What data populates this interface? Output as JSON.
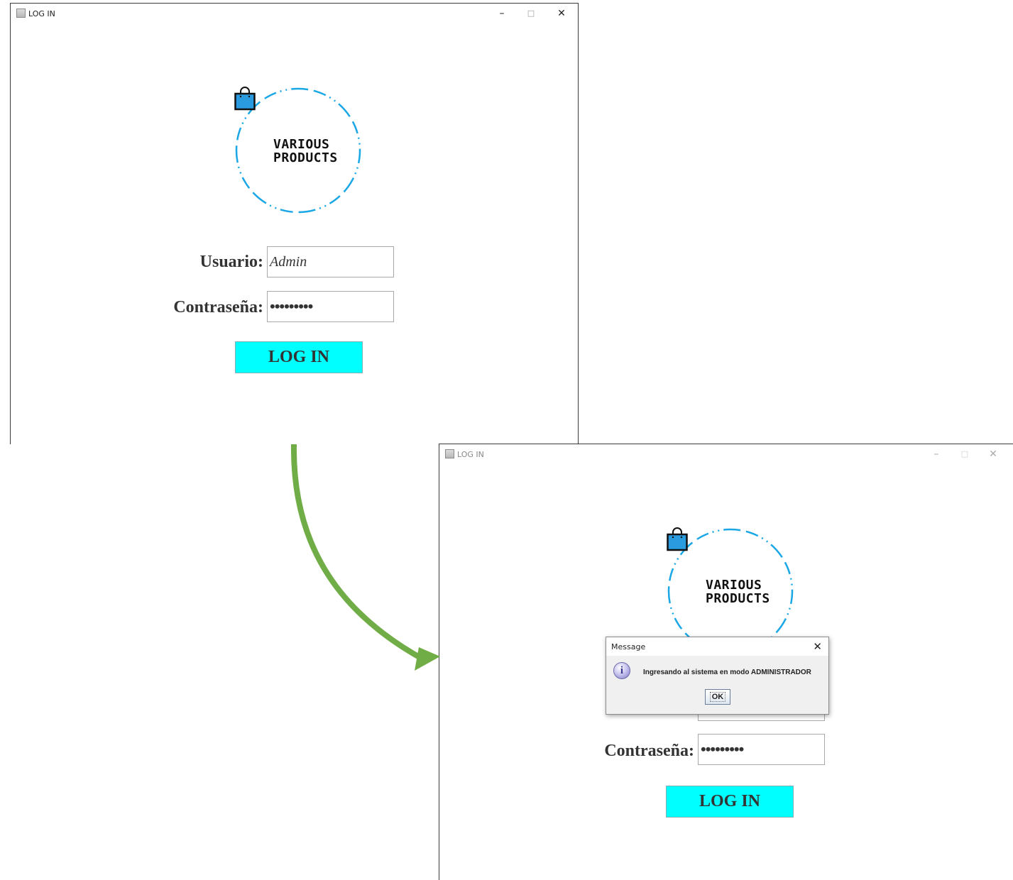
{
  "colors": {
    "accent_cyan": "#00ffff",
    "logo_ring": "#1aa7e6",
    "bag_blue": "#2b9be0",
    "arrow_green": "#70ad47"
  },
  "icons": {
    "app": "java-app-icon",
    "bag": "shopping-bag-icon",
    "info": "information-icon"
  },
  "window_before": {
    "title": "LOG IN",
    "controls": {
      "minimize": "–",
      "maximize": "□",
      "close": "✕"
    },
    "logo": {
      "line1": "VARIOUS",
      "line2": "PRODUCTS"
    },
    "form": {
      "user_label": "Usuario:",
      "user_value": "Admin",
      "pass_label": "Contraseña:",
      "pass_value": "•••••••••",
      "login_button": "LOG IN"
    }
  },
  "window_after": {
    "title": "LOG IN",
    "controls": {
      "minimize": "–",
      "maximize": "□",
      "close": "✕"
    },
    "logo": {
      "line1": "VARIOUS",
      "line2": "PRODUCTS"
    },
    "form": {
      "pass_label": "Contraseña:",
      "pass_value": "•••••••••",
      "login_button": "LOG IN"
    },
    "dialog": {
      "title": "Message",
      "close": "✕",
      "message": "Ingresando al sistema en modo ADMINISTRADOR",
      "ok_button": "OK",
      "info_glyph": "i"
    }
  }
}
